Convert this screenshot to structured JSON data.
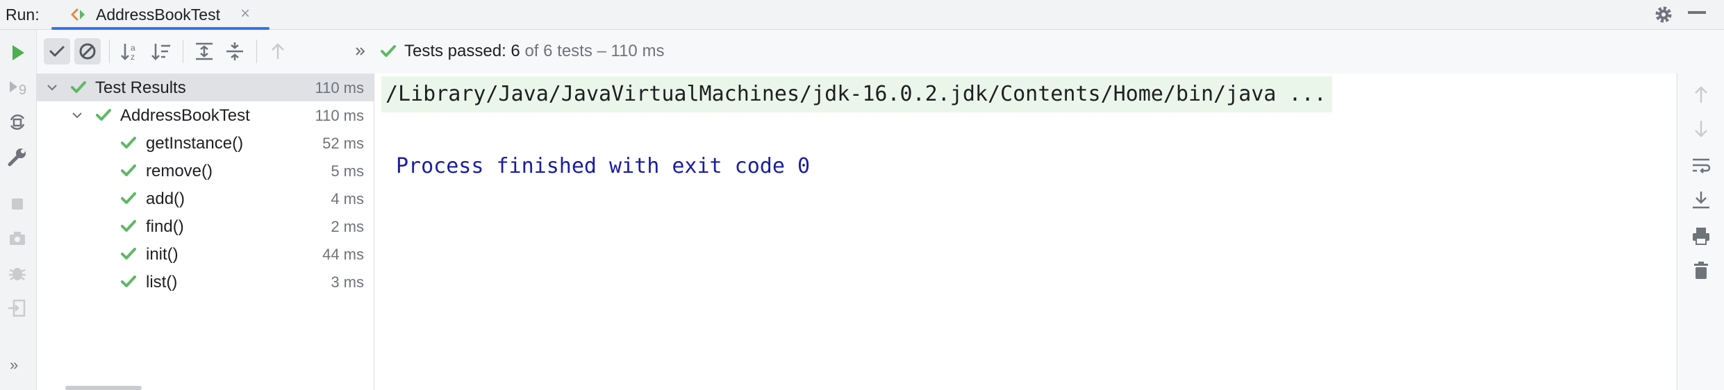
{
  "header": {
    "run_label": "Run:",
    "tab_label": "AddressBookTest",
    "tab_close": "×",
    "icons": [
      "run-config-icon",
      "gear-icon",
      "minimize-icon"
    ]
  },
  "toolbar": {
    "icons": [
      "show-passed-icon",
      "show-ignored-icon",
      "sort-alphabetically-icon",
      "sort-by-duration-icon",
      "expand-all-icon",
      "collapse-all-icon",
      "previous-failed-icon",
      "more-icon"
    ],
    "status_prefix": "Tests passed: ",
    "status_count": "6",
    "status_suffix": " of 6 tests – 110 ms"
  },
  "tree": {
    "root": {
      "label": "Test Results",
      "time": "110 ms"
    },
    "suite": {
      "label": "AddressBookTest",
      "time": "110 ms"
    },
    "tests": [
      {
        "label": "getInstance()",
        "time": "52 ms"
      },
      {
        "label": "remove()",
        "time": "5 ms"
      },
      {
        "label": "add()",
        "time": "4 ms"
      },
      {
        "label": "find()",
        "time": "2 ms"
      },
      {
        "label": "init()",
        "time": "44 ms"
      },
      {
        "label": "list()",
        "time": "3 ms"
      }
    ]
  },
  "console": {
    "command": "/Library/Java/JavaVirtualMachines/jdk-16.0.2.jdk/Contents/Home/bin/java ...",
    "exit_message": "Process finished with exit code 0"
  },
  "left_strip": {
    "icons": [
      "run-icon",
      "rerun-failed-icon",
      "toggle-autotest-icon",
      "wrench-icon",
      "stop-icon",
      "camera-icon",
      "debug-settings-icon",
      "export-icon",
      "more-icon"
    ],
    "more_label": "»"
  },
  "right_strip": {
    "icons": [
      "up-arrow-icon",
      "down-arrow-icon",
      "soft-wrap-icon",
      "scroll-to-end-icon",
      "print-icon",
      "trash-icon"
    ]
  },
  "colors": {
    "accent": "#3574f0",
    "success": "#5fb865",
    "run_green": "#4caf50",
    "console_text": "#1a1ea0",
    "command_bg": "#eaf6e9"
  }
}
